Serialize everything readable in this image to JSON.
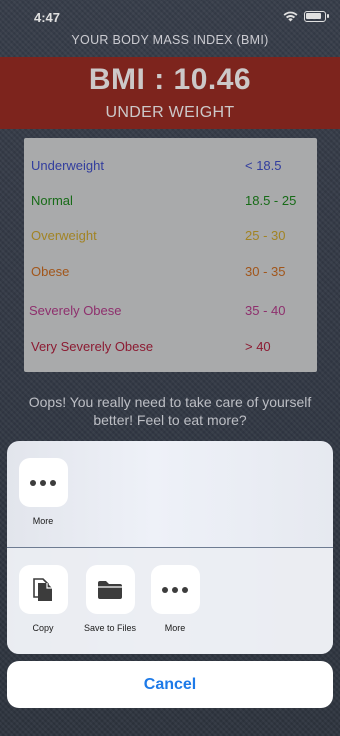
{
  "status": {
    "time": "4:47"
  },
  "header": {
    "title": "YOUR BODY MASS INDEX (BMI)"
  },
  "result": {
    "bmi": "BMI : 10.46",
    "category": "UNDER WEIGHT",
    "banner_color": "#8f2a22"
  },
  "bmi_table": [
    {
      "category": "Underweight",
      "range": "< 18.5",
      "color": "#3a47b4"
    },
    {
      "category": "Normal",
      "range": "18.5 - 25",
      "color": "#1b7a1b"
    },
    {
      "category": "Overweight",
      "range": "25 - 30",
      "color": "#b8962a"
    },
    {
      "category": "Obese",
      "range": "30 - 35",
      "color": "#b8621f"
    },
    {
      "category": "Severely Obese",
      "range": "35 - 40",
      "color": "#a2377d"
    },
    {
      "category": "Very Severely Obese",
      "range": "> 40",
      "color": "#a01f3a"
    }
  ],
  "message": "Oops! You really need to take care of yourself better! Feel to eat more?",
  "share_sheet": {
    "top_actions": [
      {
        "label": "More",
        "icon": "more-icon"
      }
    ],
    "bottom_actions": [
      {
        "label": "Copy",
        "icon": "copy-icon"
      },
      {
        "label": "Save to Files",
        "icon": "folder-icon"
      },
      {
        "label": "More",
        "icon": "more-icon"
      }
    ],
    "cancel_label": "Cancel",
    "accent": "#1d7ae8"
  }
}
